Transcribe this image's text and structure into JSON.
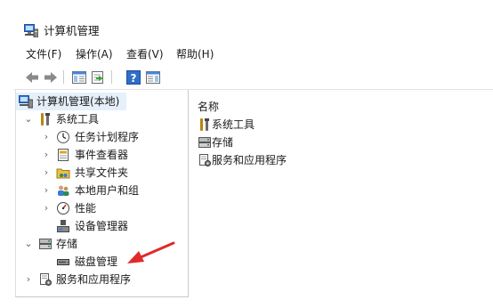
{
  "window": {
    "title": "计算机管理",
    "icon": "computer-management-icon"
  },
  "menu": [
    "文件(F)",
    "操作(A)",
    "查看(V)",
    "帮助(H)"
  ],
  "toolbar": {
    "buttons": [
      "back-icon",
      "forward-icon",
      "show-hide-tree-icon",
      "export-list-icon",
      "help-icon",
      "action-pane-icon"
    ]
  },
  "tree": {
    "root": "计算机管理(本地)",
    "system_tools": "系统工具",
    "task_scheduler": "任务计划程序",
    "event_viewer": "事件查看器",
    "shared_folders": "共享文件夹",
    "local_users": "本地用户和组",
    "performance": "性能",
    "device_manager": "设备管理器",
    "storage": "存储",
    "disk_management": "磁盘管理",
    "services_apps": "服务和应用程序"
  },
  "right_pane": {
    "column_header": "名称",
    "items": [
      "系统工具",
      "存储",
      "服务和应用程序"
    ]
  },
  "colors": {
    "selection": "#e5f0fb",
    "arrow": "#e02a2a",
    "accent": "#1c6fc4"
  }
}
